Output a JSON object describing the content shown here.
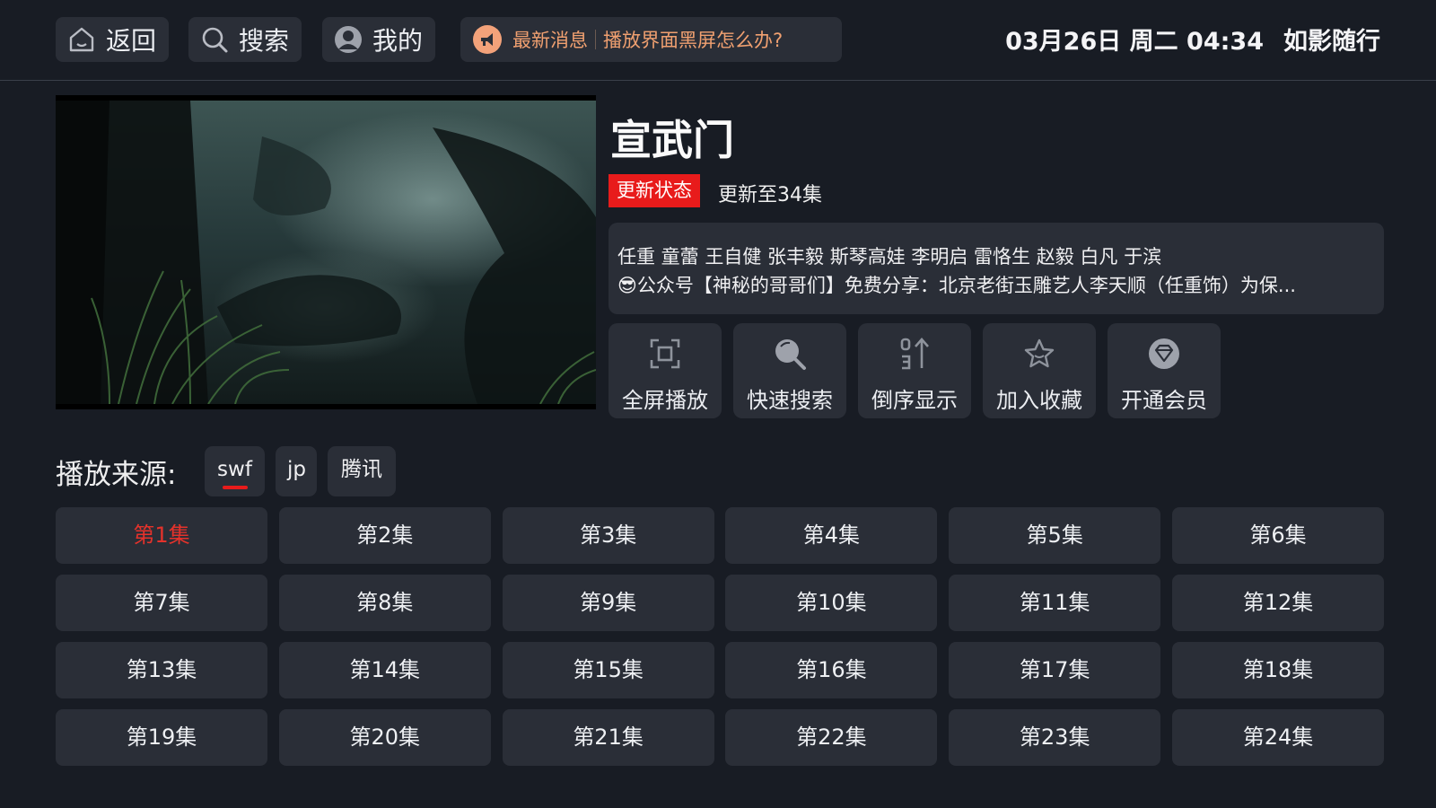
{
  "topbar": {
    "nav": [
      {
        "label": "返回",
        "icon": "home-icon"
      },
      {
        "label": "搜索",
        "icon": "search-icon"
      },
      {
        "label": "我的",
        "icon": "user-icon"
      }
    ],
    "news": {
      "label": "最新消息",
      "text": "播放界面黑屏怎么办?",
      "icon": "megaphone-icon"
    },
    "datetime": "03月26日 周二 04:34",
    "app_name": "如影随行"
  },
  "detail": {
    "title": "宣武门",
    "status_tag": "更新状态",
    "status_text": "更新至34集",
    "cast": "任重 童蕾 王自健 张丰毅 斯琴高娃 李明启 雷恪生 赵毅 白凡 于滨",
    "summary": "😎公众号【神秘的哥哥们】免费分享：北京老街玉雕艺人李天顺（任重饰）为保..."
  },
  "actions": [
    {
      "label": "全屏播放",
      "icon": "fullscreen-icon"
    },
    {
      "label": "快速搜索",
      "icon": "search-icon"
    },
    {
      "label": "倒序显示",
      "icon": "sort-icon"
    },
    {
      "label": "加入收藏",
      "icon": "star-icon"
    },
    {
      "label": "开通会员",
      "icon": "diamond-icon"
    }
  ],
  "sources": {
    "label": "播放来源:",
    "items": [
      "swf",
      "jp",
      "腾讯"
    ],
    "selected": "swf"
  },
  "episodes": {
    "items": [
      "第1集",
      "第2集",
      "第3集",
      "第4集",
      "第5集",
      "第6集",
      "第7集",
      "第8集",
      "第9集",
      "第10集",
      "第11集",
      "第12集",
      "第13集",
      "第14集",
      "第15集",
      "第16集",
      "第17集",
      "第18集",
      "第19集",
      "第20集",
      "第21集",
      "第22集",
      "第23集",
      "第24集"
    ],
    "active": "第1集"
  },
  "colors": {
    "accent": "#e81b1b",
    "panel": "#2a2e37",
    "background": "#181c24"
  }
}
